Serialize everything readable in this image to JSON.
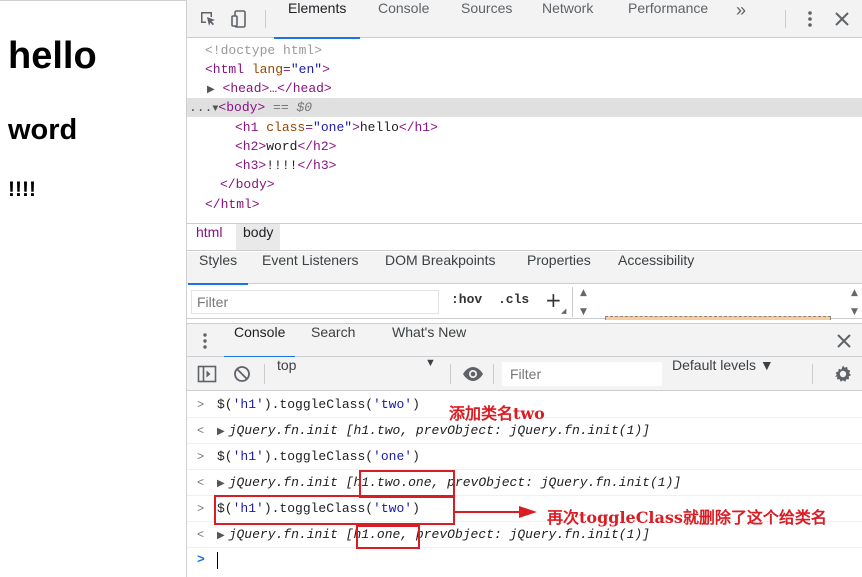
{
  "preview": {
    "h1": "hello",
    "h2": "word",
    "h3": "!!!!"
  },
  "devtools": {
    "tabs": [
      "Elements",
      "Console",
      "Sources",
      "Network",
      "Performance"
    ],
    "more": "»",
    "dom": {
      "doctype": "<!doctype html>",
      "html_open_tag": "<html",
      "lang_attr": "lang",
      "lang_val": "\"en\"",
      "close_gt": ">",
      "head": "<head>…</head>",
      "ellipsis": "...",
      "body_open": "<body>",
      "body_eq": "== $0",
      "h1_open": "<h1",
      "class_attr": "class",
      "class_val": "\"one\"",
      "h1_text": "hello",
      "h1_close": "</h1>",
      "h2_open": "<h2>",
      "h2_text": "word",
      "h2_close": "</h2>",
      "h3_open": "<h3>",
      "h3_text": "!!!!",
      "h3_close": "</h3>",
      "body_close": "</body>",
      "html_close": "</html>"
    },
    "breadcrumbs": [
      "html",
      "body"
    ],
    "styles_tabs": [
      "Styles",
      "Event Listeners",
      "DOM Breakpoints",
      "Properties",
      "Accessibility"
    ],
    "styles_filter_placeholder": "Filter",
    "hov": ":hov",
    "cls": ".cls",
    "plus": "+",
    "drawer": {
      "tabs": [
        "Console",
        "Search",
        "What's New"
      ],
      "context": "top",
      "filter_placeholder": "Filter",
      "levels": "Default levels ▼"
    },
    "console": {
      "lines": [
        {
          "pre": "$(",
          "s1": "'h1'",
          "mid": ").toggleClass(",
          "s2": "'two'",
          "post": ")"
        },
        {
          "result": "jQuery.fn.init [h1.two, prevObject: jQuery.fn.init(1)]"
        },
        {
          "pre": "$(",
          "s1": "'h1'",
          "mid": ").toggleClass(",
          "s2": "'one'",
          "post": ")"
        },
        {
          "result": "jQuery.fn.init [h1.two.one, prevObject: jQuery.fn.init(1)]"
        },
        {
          "pre": "$(",
          "s1": "'h1'",
          "mid": ").toggleClass(",
          "s2": "'two'",
          "post": ")"
        },
        {
          "result": "jQuery.fn.init [h1.one, prevObject: jQuery.fn.init(1)]"
        }
      ],
      "prompt": ">",
      "result_marker": "<"
    }
  },
  "annotations": {
    "note1": "添加类名two",
    "note2": "再次toggleClass就删除了这个给类名"
  },
  "colors": {
    "accent": "#1a73e8",
    "annotation": "#d91d24",
    "tag": "#881280"
  }
}
